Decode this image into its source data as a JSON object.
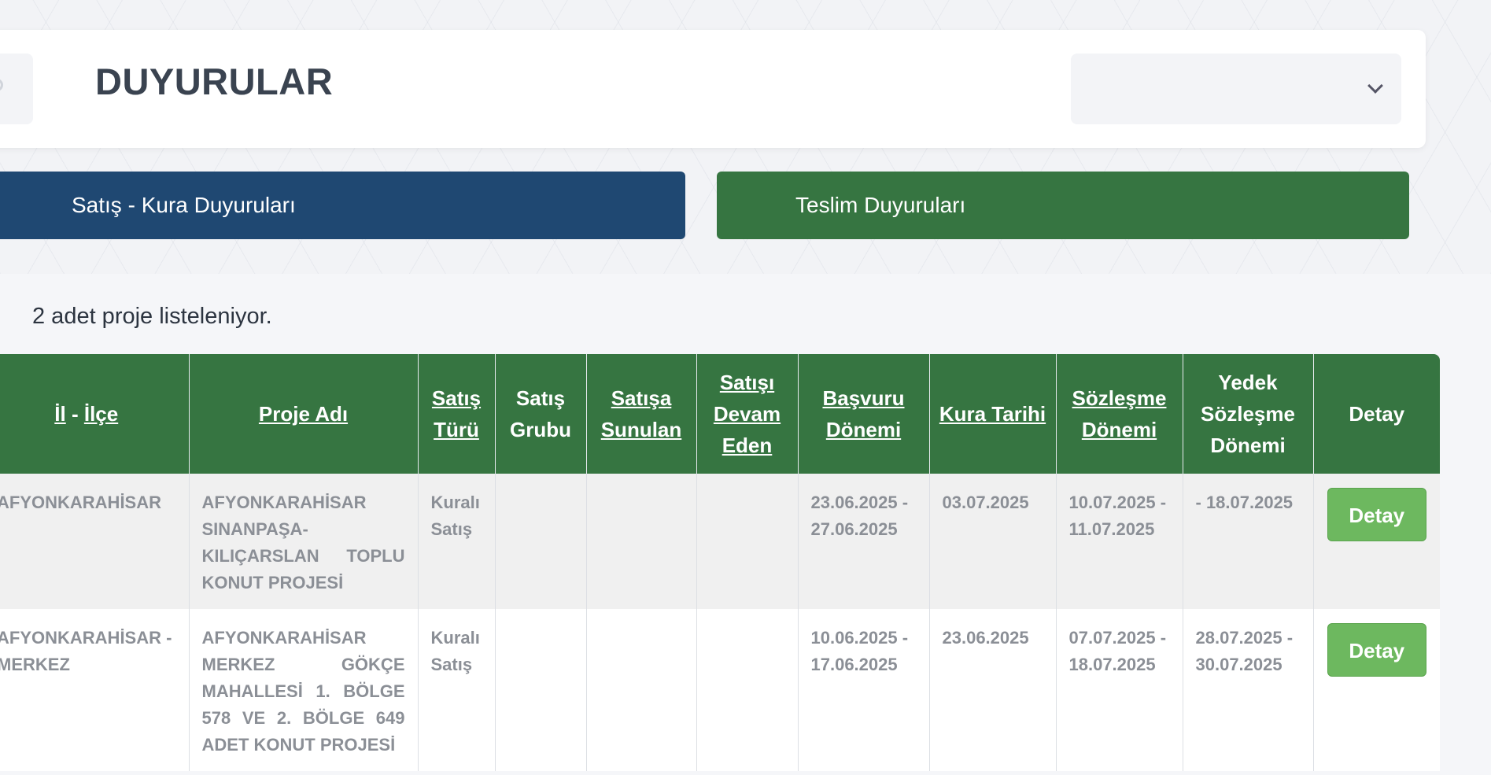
{
  "header": {
    "title": "DUYURULAR",
    "select_value": ""
  },
  "tabs": [
    {
      "label": "Satış - Kura Duyuruları"
    },
    {
      "label": "Teslim Duyuruları"
    }
  ],
  "listing": {
    "count_text": "2 adet proje listeleniyor."
  },
  "table": {
    "columns": {
      "il_ilce": {
        "il": "İl",
        "sep": " - ",
        "ilce": "İlçe"
      },
      "proje_adi": "Proje Adı",
      "satis_turu": "Satış Türü",
      "satis_grubu": "Satış Grubu",
      "satisa_sunulan": "Satışa Sunulan",
      "satisi_devam_eden": "Satışı Devam Eden",
      "basvuru_donemi": "Başvuru Dönemi",
      "kura_tarihi": "Kura Tarihi",
      "sozlesme_donemi": "Sözleşme Dönemi",
      "yedek_sozlesme_donemi": "Yedek Sözleşme Dönemi",
      "detay": "Detay"
    },
    "rows": [
      {
        "il_ilce": "AFYONKARAHİSAR",
        "proje_adi": "AFYONKARAHİSAR SINANPAŞA-KILIÇARSLAN TOPLU KONUT PROJESİ",
        "satis_turu": "Kuralı Satış",
        "satis_grubu": "",
        "satisa_sunulan": "",
        "satisi_devam_eden": "",
        "basvuru_donemi": "23.06.2025 - 27.06.2025",
        "kura_tarihi": "03.07.2025",
        "sozlesme_donemi": "10.07.2025 - 11.07.2025",
        "yedek_sozlesme_donemi": "- 18.07.2025",
        "detay_label": "Detay"
      },
      {
        "il_ilce": "AFYONKARAHİSAR - MERKEZ",
        "proje_adi": "AFYONKARAHİSAR MERKEZ GÖKÇE MAHALLESİ 1. BÖLGE 578 VE 2. BÖLGE 649 ADET KONUT PROJESİ",
        "satis_turu": "Kuralı Satış",
        "satis_grubu": "",
        "satisa_sunulan": "",
        "satisi_devam_eden": "",
        "basvuru_donemi": "10.06.2025 - 17.06.2025",
        "kura_tarihi": "23.06.2025",
        "sozlesme_donemi": "07.07.2025 - 18.07.2025",
        "yedek_sozlesme_donemi": "28.07.2025 - 30.07.2025",
        "detay_label": "Detay"
      }
    ]
  }
}
